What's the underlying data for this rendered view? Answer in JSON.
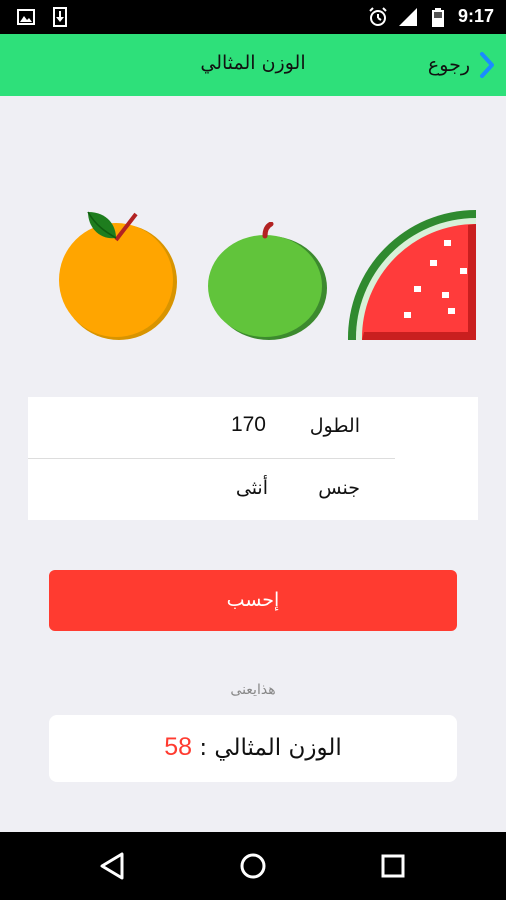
{
  "status_bar": {
    "time": "9:17",
    "icons": [
      "image-icon",
      "download-icon",
      "alarm-icon",
      "signal-icon",
      "battery-icon"
    ]
  },
  "app_bar": {
    "title": "الوزن المثالي",
    "back_label": "رجوع",
    "background": "#2ee07a"
  },
  "fruits": [
    "orange-icon",
    "apple-icon",
    "watermelon-icon"
  ],
  "form": {
    "height_label": "الطول",
    "height_value": "170",
    "gender_label": "جنس",
    "gender_value": "أنثى"
  },
  "calculate_button": {
    "label": "إحسب",
    "color": "#ff3b30"
  },
  "caption": "هذايعنى",
  "result": {
    "label": "الوزن المثالي :",
    "value": "58",
    "value_color": "#ff3b30"
  },
  "nav_bar": {
    "buttons": [
      "back-triangle-icon",
      "home-circle-icon",
      "recents-square-icon"
    ]
  }
}
